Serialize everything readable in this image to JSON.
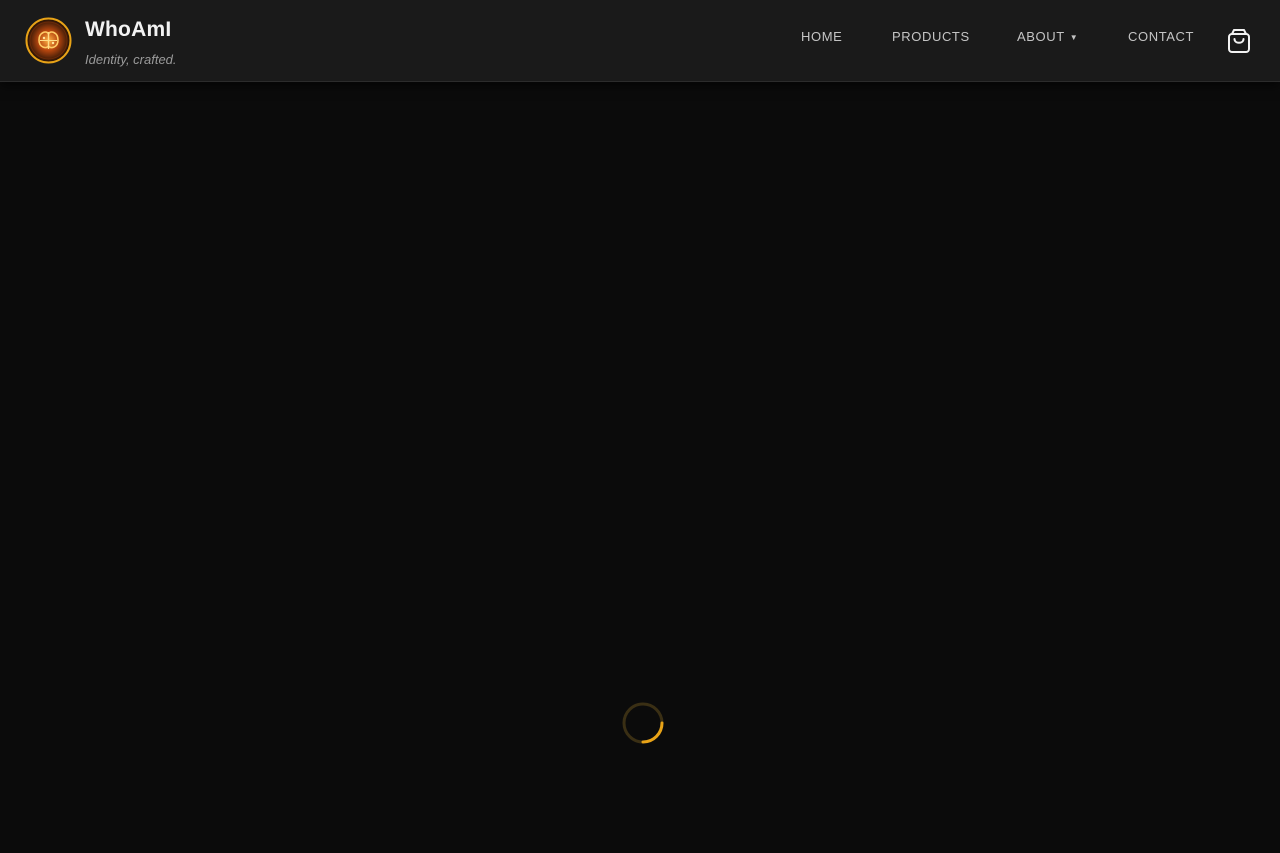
{
  "header": {
    "brand_name": "WhoAmI",
    "tagline": "Identity, crafted.",
    "logo_icon": "brain-logo-icon",
    "nav": [
      {
        "label": "HOME"
      },
      {
        "label": "PRODUCTS"
      },
      {
        "label": "ABOUT",
        "caret": "▼"
      },
      {
        "label": "CONTACT"
      }
    ],
    "cart_icon": "shopping-bag-icon"
  },
  "main": {
    "loading_icon": "spinner-icon"
  },
  "colors": {
    "background": "#0b0b0b",
    "header_background": "#1a1a1a",
    "accent": "#e8a317"
  }
}
